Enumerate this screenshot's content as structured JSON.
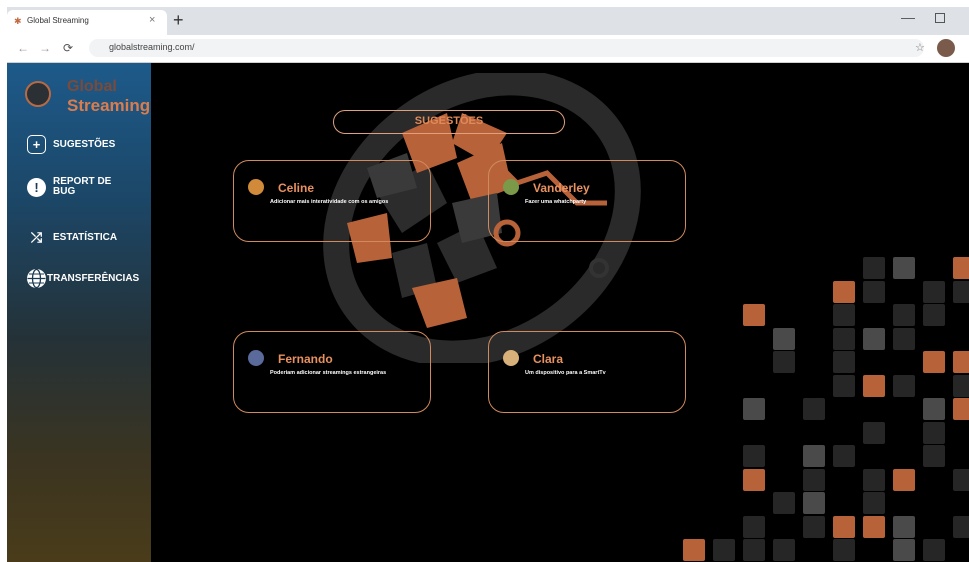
{
  "browser": {
    "tab_title": "Global Streaming",
    "tab_close": "×",
    "new_tab": "+",
    "url": "globalstreaming.com/",
    "back": "←",
    "forward": "→",
    "reload": "⟳",
    "star": "☆",
    "minimize": "—"
  },
  "sidebar": {
    "brand_line1": "Global",
    "brand_line2": "Streaming",
    "items": [
      {
        "label": "SUGESTÕES",
        "icon": "plus-icon",
        "glyph": "+"
      },
      {
        "label": "REPORT DE BUG",
        "icon": "alert-icon",
        "glyph": "!"
      },
      {
        "label": "ESTATÍSTICA",
        "icon": "shuffle-icon",
        "glyph": "⤮"
      },
      {
        "label": "TRANSFERÊNCIAS",
        "icon": "globe-icon",
        "glyph": "🌐"
      }
    ]
  },
  "main": {
    "title": "SUGESTÕES",
    "cards": [
      {
        "name": "Celine",
        "text": "Adicionar mais interatividade com os amigos"
      },
      {
        "name": "Vanderley",
        "text": "Fazer uma whatchparty"
      },
      {
        "name": "Fernando",
        "text": "Poderiam adicionar streamings estrangeiras"
      },
      {
        "name": "Clara",
        "text": "Um dispositivo para a SmartTv"
      }
    ]
  },
  "colors": {
    "accent": "#e8915f",
    "sidebar_top": "#1d5a8a",
    "sidebar_bottom": "#4a3c1a",
    "background": "#000000"
  }
}
